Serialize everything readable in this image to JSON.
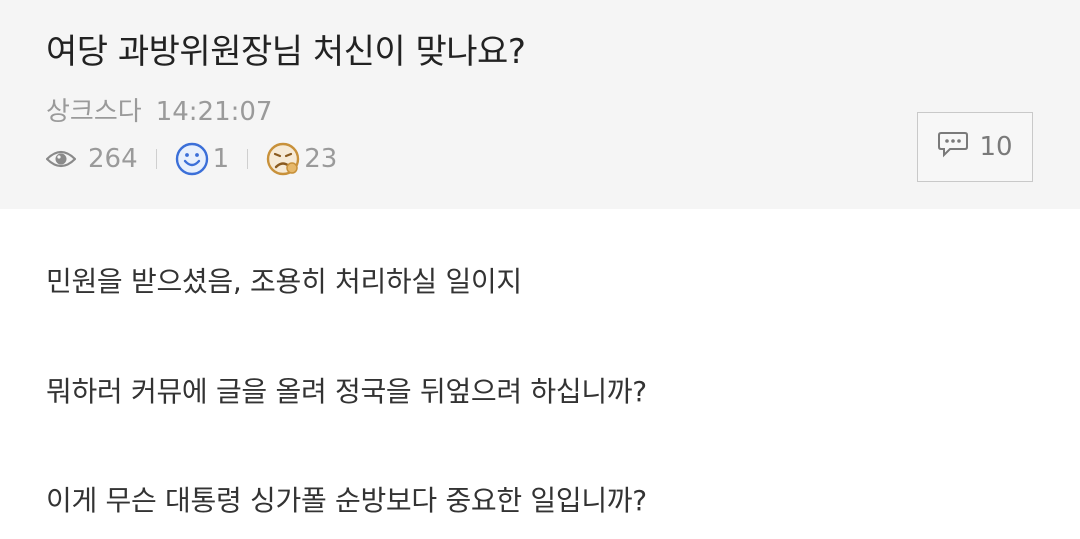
{
  "post": {
    "title": "여당 과방위원장님 처신이 맞나요?",
    "author": "상크스다",
    "time": "14:21:07",
    "views": "264",
    "likes": "1",
    "dislikes": "23",
    "comments": "10"
  },
  "icons": {
    "views": "eye-icon",
    "likes": "smiley-icon",
    "dislikes": "frown-face-icon",
    "comments": "speech-bubble-icon"
  },
  "colors": {
    "header_bg": "#f5f5f5",
    "like_icon": "#3b6fd8",
    "dislike_icon": "#c8913a",
    "muted_text": "#9a9a9a"
  },
  "content": {
    "lines": [
      "민원을 받으셨음, 조용히 처리하실 일이지",
      "뭐하러 커뮤에 글을 올려 정국을 뒤엎으려 하십니까?",
      "이게 무슨 대통령 싱가폴 순방보다 중요한 일입니까?"
    ]
  }
}
